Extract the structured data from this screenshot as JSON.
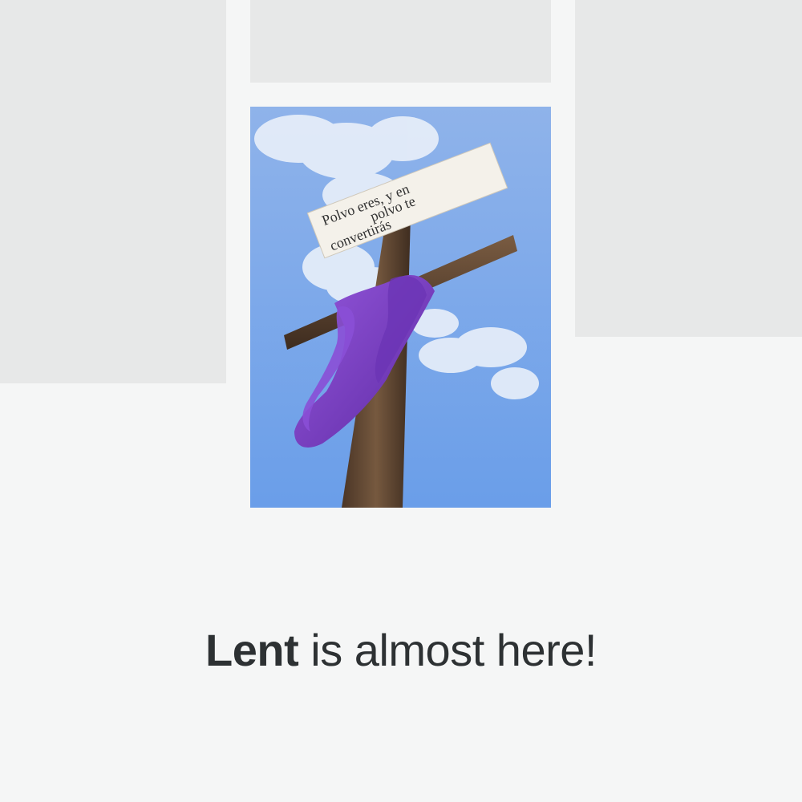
{
  "feed": {
    "placeholders": [
      "left-tile",
      "top-tile",
      "right-tile"
    ]
  },
  "photo": {
    "sign_text": [
      "Polvo eres, y en",
      "polvo te",
      "convertirás"
    ],
    "sky_color": "#6f9fe6",
    "cloth_color": "#7b3fc4",
    "wood_color": "#5b4431"
  },
  "headline": {
    "bold": "Lent",
    "rest": " is almost here!"
  },
  "colors": {
    "background": "#f5f6f6",
    "placeholder": "#e7e8e8",
    "text": "#2d3133"
  }
}
